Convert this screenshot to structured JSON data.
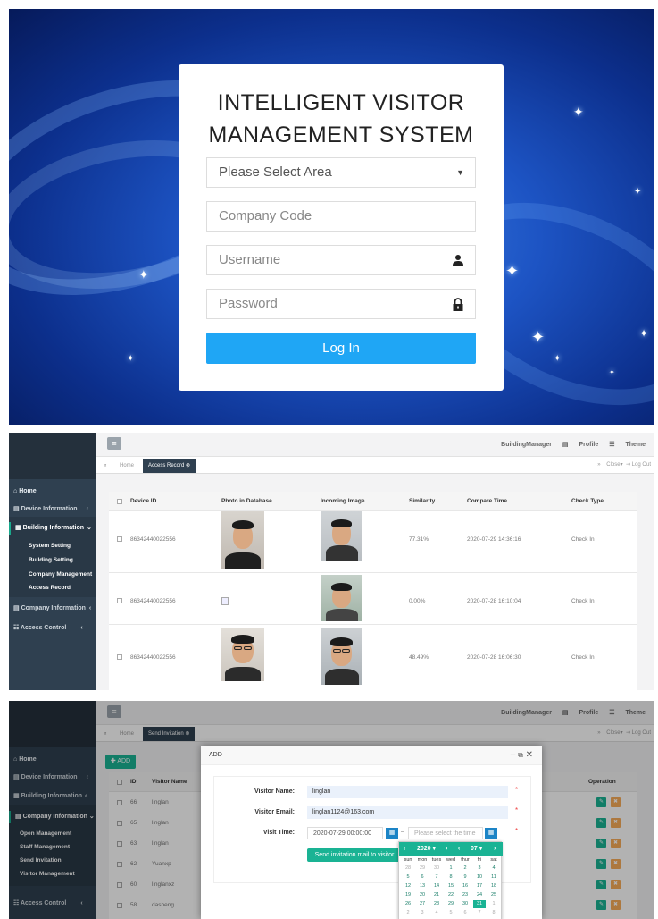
{
  "login": {
    "title_line1": "INTELLIGENT VISITOR",
    "title_line2": "MANAGEMENT SYSTEM",
    "area_select": "Please Select Area",
    "company_code_placeholder": "Company Code",
    "username_placeholder": "Username",
    "password_placeholder": "Password",
    "login_button": "Log In",
    "colors": {
      "button": "#1fa6f5",
      "background": "#1d54c4"
    }
  },
  "header": {
    "user": "BuildingManager",
    "profile": "Profile",
    "theme": "Theme",
    "close": "Close",
    "logout": "Log Out",
    "home_tab": "Home"
  },
  "sidebar": {
    "home": "Home",
    "device_information": "Device Information",
    "building_information": "Building Information",
    "building_sub": [
      "System Setting",
      "Building Setting",
      "Company Management",
      "Access Record"
    ],
    "company_information": "Company Information",
    "company_sub": [
      "Open Management",
      "Staff Management",
      "Send Invitation",
      "Visitor Management"
    ],
    "access_control": "Access Control"
  },
  "access_record": {
    "tab": "Access Record",
    "columns": [
      "Device ID",
      "Photo in Database",
      "Incoming Image",
      "Similarity",
      "Compare Time",
      "Check Type"
    ],
    "rows": [
      {
        "device_id": "86342440022556",
        "similarity": "77.31%",
        "time": "2020-07-29 14:36:16",
        "type": "Check In"
      },
      {
        "device_id": "86342440022556",
        "similarity": "0.00%",
        "time": "2020-07-28 16:10:04",
        "type": "Check In"
      },
      {
        "device_id": "86342440022556",
        "similarity": "48.49%",
        "time": "2020-07-28 16:06:30",
        "type": "Check In"
      }
    ]
  },
  "send_invitation": {
    "tab": "Send Invitation",
    "add_button": "ADD",
    "columns": [
      "ID",
      "Visitor Name",
      "Operation"
    ],
    "rows": [
      {
        "id": "66",
        "name": "linglan"
      },
      {
        "id": "65",
        "name": "linglan"
      },
      {
        "id": "63",
        "name": "linglan"
      },
      {
        "id": "62",
        "name": "Yuanxp"
      },
      {
        "id": "60",
        "name": "linglanxz"
      },
      {
        "id": "58",
        "name": "dasheng"
      }
    ],
    "modal": {
      "title": "ADD",
      "visitor_name_label": "Visitor Name:",
      "visitor_name_value": "linglan",
      "visitor_email_label": "Visitor Email:",
      "visitor_email_value": "linglan1124@163.com",
      "visit_time_label": "Visit Time:",
      "visit_time_start": "2020-07-29 00:00:00",
      "visit_time_end_placeholder": "Please select the time",
      "send_button": "Send invitation mail to visitor"
    },
    "calendar": {
      "year": "2020",
      "month": "07",
      "weekdays": [
        "sun",
        "mon",
        "tues",
        "wed",
        "thur",
        "fri",
        "sat"
      ],
      "days": [
        [
          "28",
          "29",
          "30",
          "1",
          "2",
          "3",
          "4"
        ],
        [
          "5",
          "6",
          "7",
          "8",
          "9",
          "10",
          "11"
        ],
        [
          "12",
          "13",
          "14",
          "15",
          "16",
          "17",
          "18"
        ],
        [
          "19",
          "20",
          "21",
          "22",
          "23",
          "24",
          "25"
        ],
        [
          "26",
          "27",
          "28",
          "29",
          "30",
          "31",
          "1"
        ],
        [
          "2",
          "3",
          "4",
          "5",
          "6",
          "7",
          "8"
        ]
      ],
      "selected": "31"
    }
  }
}
